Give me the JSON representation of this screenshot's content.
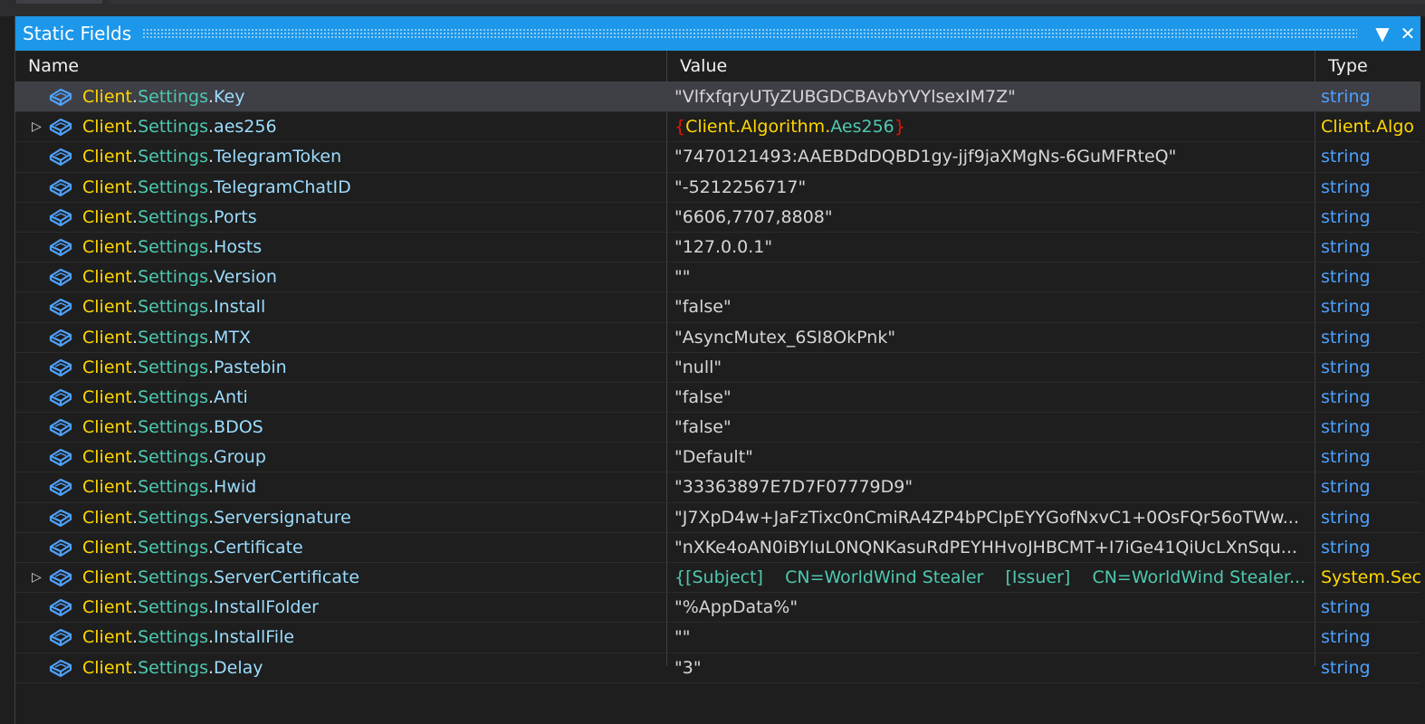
{
  "window": {
    "title": "Static Fields",
    "dropdown_icon": "▼",
    "close_icon": "✕"
  },
  "columns": {
    "name": "Name",
    "value": "Value",
    "type": "Type"
  },
  "colors": {
    "titlebar": "#1c97ea",
    "selected_row": "#3f3f46",
    "type_text": "#4ea1ff"
  },
  "rows": [
    {
      "ns": "Client",
      "mid": "Settings",
      "field": "Key",
      "value": "\"VlfxfqryUTyZUBGDCBAvbYVYlsexIM7Z\"",
      "type": "string",
      "expandable": false
    },
    {
      "ns": "Client",
      "mid": "Settings",
      "field": "aes256",
      "value_obj": {
        "open": "{",
        "a": "Client.Algorithm.",
        "b": "Aes256",
        "close": "}"
      },
      "type": "Client.Algo",
      "expandable": true
    },
    {
      "ns": "Client",
      "mid": "Settings",
      "field": "TelegramToken",
      "value": "\"7470121493:AAEBDdDQBD1gy-jjf9jaXMgNs-6GuMFRteQ\"",
      "type": "string",
      "expandable": false
    },
    {
      "ns": "Client",
      "mid": "Settings",
      "field": "TelegramChatID",
      "value": "\"-5212256717\"",
      "type": "string",
      "expandable": false
    },
    {
      "ns": "Client",
      "mid": "Settings",
      "field": "Ports",
      "value": "\"6606,7707,8808\"",
      "type": "string",
      "expandable": false
    },
    {
      "ns": "Client",
      "mid": "Settings",
      "field": "Hosts",
      "value": "\"127.0.0.1\"",
      "type": "string",
      "expandable": false
    },
    {
      "ns": "Client",
      "mid": "Settings",
      "field": "Version",
      "value": "\"\"",
      "type": "string",
      "expandable": false
    },
    {
      "ns": "Client",
      "mid": "Settings",
      "field": "Install",
      "value": "\"false\"",
      "type": "string",
      "expandable": false
    },
    {
      "ns": "Client",
      "mid": "Settings",
      "field": "MTX",
      "value": "\"AsyncMutex_6SI8OkPnk\"",
      "type": "string",
      "expandable": false
    },
    {
      "ns": "Client",
      "mid": "Settings",
      "field": "Pastebin",
      "value": "\"null\"",
      "type": "string",
      "expandable": false
    },
    {
      "ns": "Client",
      "mid": "Settings",
      "field": "Anti",
      "value": "\"false\"",
      "type": "string",
      "expandable": false
    },
    {
      "ns": "Client",
      "mid": "Settings",
      "field": "BDOS",
      "value": "\"false\"",
      "type": "string",
      "expandable": false
    },
    {
      "ns": "Client",
      "mid": "Settings",
      "field": "Group",
      "value": "\"Default\"",
      "type": "string",
      "expandable": false
    },
    {
      "ns": "Client",
      "mid": "Settings",
      "field": "Hwid",
      "value": "\"33363897E7D7F07779D9\"",
      "type": "string",
      "expandable": false
    },
    {
      "ns": "Client",
      "mid": "Settings",
      "field": "Serversignature",
      "value": "\"J7XpD4w+JaFzTixc0nCmiRA4ZP4bPClpEYYGofNxvC1+0OsFQr56oTWw...",
      "type": "string",
      "expandable": false
    },
    {
      "ns": "Client",
      "mid": "Settings",
      "field": "Certificate",
      "value": "\"nXKe4oAN0iBYIuL0NQNKasuRdPEYHHvoJHBCMT+I7iGe41QiUcLXnSqu...",
      "type": "string",
      "expandable": false
    },
    {
      "ns": "Client",
      "mid": "Settings",
      "field": "ServerCertificate",
      "value_cert": "{[Subject]    CN=WorldWind Stealer    [Issuer]    CN=WorldWind Stealer...",
      "type": "System.Sec",
      "expandable": true
    },
    {
      "ns": "Client",
      "mid": "Settings",
      "field": "InstallFolder",
      "value": "\"%AppData%\"",
      "type": "string",
      "expandable": false
    },
    {
      "ns": "Client",
      "mid": "Settings",
      "field": "InstallFile",
      "value": "\"\"",
      "type": "string",
      "expandable": false
    },
    {
      "ns": "Client",
      "mid": "Settings",
      "field": "Delay",
      "value": "\"3\"",
      "type": "string",
      "expandable": false
    }
  ]
}
